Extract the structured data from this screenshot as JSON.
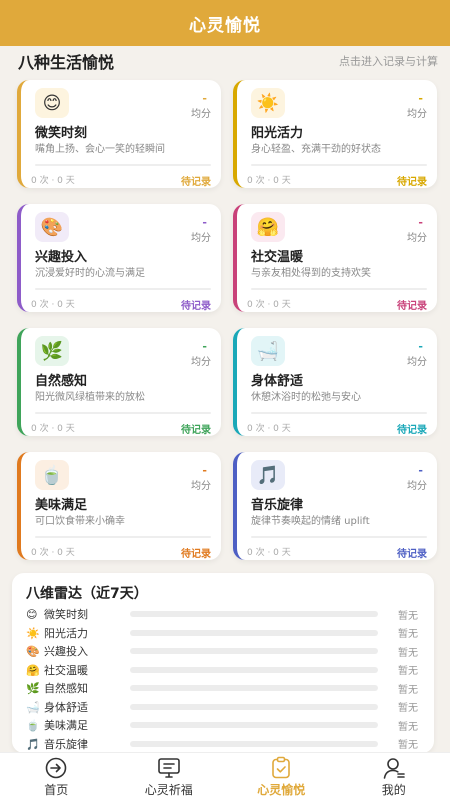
{
  "header": {
    "title": "心灵愉悦"
  },
  "section": {
    "title": "八种生活愉悦",
    "hint": "点击进入记录与计算"
  },
  "cards": [
    {
      "icon": "😊",
      "icon_name": "smiley-icon",
      "score": "-",
      "unit": "均分",
      "name": "微笑时刻",
      "desc": "嘴角上扬、会心一笑的轻瞬间",
      "stats": "0 次 · 0 天",
      "action": "待记录",
      "color": "#e0a93b",
      "icon_bg": "#fdf4df"
    },
    {
      "icon": "☀️",
      "icon_name": "sun-icon",
      "score": "-",
      "unit": "均分",
      "name": "阳光活力",
      "desc": "身心轻盈、充满干劲的好状态",
      "stats": "0 次 · 0 天",
      "action": "待记录",
      "color": "#d8a800",
      "icon_bg": "#fdf4df"
    },
    {
      "icon": "🎨",
      "icon_name": "palette-icon",
      "score": "-",
      "unit": "均分",
      "name": "兴趣投入",
      "desc": "沉浸爱好时的心流与满足",
      "stats": "0 次 · 0 天",
      "action": "待记录",
      "color": "#8e5cc9",
      "icon_bg": "#f1ebf8"
    },
    {
      "icon": "🤗",
      "icon_name": "hug-icon",
      "score": "-",
      "unit": "均分",
      "name": "社交温暖",
      "desc": "与亲友相处得到的支持欢笑",
      "stats": "0 次 · 0 天",
      "action": "待记录",
      "color": "#c9427a",
      "icon_bg": "#fbe9f0"
    },
    {
      "icon": "🌿",
      "icon_name": "leaf-icon",
      "score": "-",
      "unit": "均分",
      "name": "自然感知",
      "desc": "阳光微风绿植带来的放松",
      "stats": "0 次 · 0 天",
      "action": "待记录",
      "color": "#3fa45a",
      "icon_bg": "#e6f5ea"
    },
    {
      "icon": "🛁",
      "icon_name": "bathtub-icon",
      "score": "-",
      "unit": "均分",
      "name": "身体舒适",
      "desc": "休憩沐浴时的松弛与安心",
      "stats": "0 次 · 0 天",
      "action": "待记录",
      "color": "#1aa8b8",
      "icon_bg": "#e2f5f7"
    },
    {
      "icon": "🍵",
      "icon_name": "tea-icon",
      "score": "-",
      "unit": "均分",
      "name": "美味满足",
      "desc": "可口饮食带来小确幸",
      "stats": "0 次 · 0 天",
      "action": "待记录",
      "color": "#e07a1f",
      "icon_bg": "#fcefe2"
    },
    {
      "icon": "🎵",
      "icon_name": "music-note-icon",
      "score": "-",
      "unit": "均分",
      "name": "音乐旋律",
      "desc": "旋律节奏唤起的情绪 uplift",
      "stats": "0 次 · 0 天",
      "action": "待记录",
      "color": "#4e5fc4",
      "icon_bg": "#e8ebf8"
    }
  ],
  "radar": {
    "title": "八维雷达（近7天）",
    "rows": [
      {
        "icon": "😊",
        "label": "微笑时刻",
        "value": "暂无"
      },
      {
        "icon": "☀️",
        "label": "阳光活力",
        "value": "暂无"
      },
      {
        "icon": "🎨",
        "label": "兴趣投入",
        "value": "暂无"
      },
      {
        "icon": "🤗",
        "label": "社交温暖",
        "value": "暂无"
      },
      {
        "icon": "🌿",
        "label": "自然感知",
        "value": "暂无"
      },
      {
        "icon": "🛁",
        "label": "身体舒适",
        "value": "暂无"
      },
      {
        "icon": "🍵",
        "label": "美味满足",
        "value": "暂无"
      },
      {
        "icon": "🎵",
        "label": "音乐旋律",
        "value": "暂无"
      }
    ]
  },
  "tabbar": {
    "active_color": "#e0a93b",
    "items": [
      {
        "label": "首页",
        "icon_name": "home-arrow-icon"
      },
      {
        "label": "心灵祈福",
        "icon_name": "monitor-icon"
      },
      {
        "label": "心灵愉悦",
        "icon_name": "clipboard-check-icon",
        "active": true
      },
      {
        "label": "我的",
        "icon_name": "user-icon"
      }
    ]
  }
}
